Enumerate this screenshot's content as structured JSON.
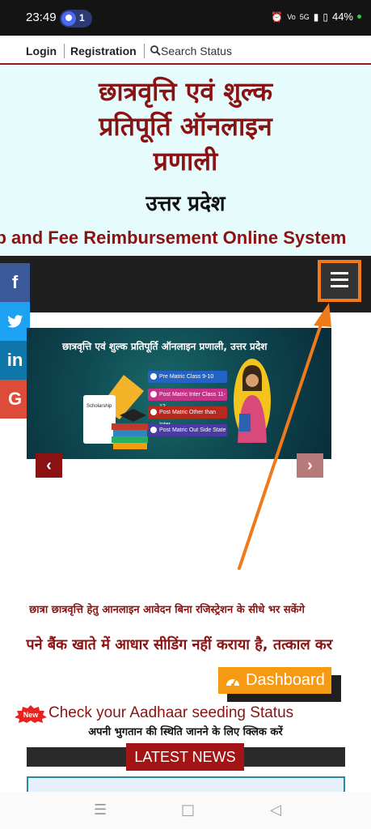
{
  "status_bar": {
    "time": "23:49",
    "notification_count": "1",
    "right_icons": [
      "alarm-icon",
      "volte-icon",
      "signal-icon",
      "battery-icon"
    ],
    "network": "5G",
    "battery": "44%"
  },
  "top_nav": {
    "login": "Login",
    "registration": "Registration",
    "search_status": "Search Status"
  },
  "header": {
    "title_line1": "छात्रवृत्ति एवं शुल्क",
    "title_line2": "प्रतिपूर्ति ऑनलाइन",
    "title_line3": "प्रणाली",
    "state": "उत्तर प्रदेश",
    "marquee_text": "Scholarship and Fee Reimbursement Online System"
  },
  "social": [
    {
      "name": "facebook",
      "glyph": "f",
      "color": "#3b5998"
    },
    {
      "name": "twitter",
      "glyph": "t",
      "color": "#1da1f2"
    },
    {
      "name": "linkedin",
      "glyph": "in",
      "color": "#0e76a8"
    },
    {
      "name": "google",
      "glyph": "G",
      "color": "#dd4b39"
    }
  ],
  "banner": {
    "title": "छात्रवृत्ति एवं शुल्क प्रतिपूर्ति ऑनलाइन प्रणाली, उत्तर प्रदेश",
    "scheme_label": "Scholarship",
    "options": [
      "Pre Matric Class 9-10",
      "Post Matric Inter Class 11-12",
      "Post Matric Other than Inter",
      "Post Matric Out Side State"
    ],
    "prev": "‹",
    "next": "›"
  },
  "marquee1": "छात्र छात्रा छात्रवृत्ति हेतु आनलाइन आवेदन बिना रजिस्ट्रेशन के सीधे भर सकेंगे",
  "marquee2": "जिन छात्रों ने अपने बैंक खाते में आधार सीडिंग नहीं कराया है, तत्काल करा लें",
  "dashboard": "Dashboard",
  "new_badge": "New",
  "aadhaar_link": "Check your Aadhaar seeding Status",
  "payment_link": "अपनी भुगतान की स्थिति जानने के लिए क्लिक करें",
  "latest_news": "LATEST NEWS",
  "colors": {
    "brand_maroon": "#8b1212",
    "header_bg": "#e6fbfb",
    "menubar": "#1f1f1f",
    "highlight_orange": "#f07a1a",
    "dashboard_orange": "#f79a13"
  },
  "android_nav": {
    "recent": "☰",
    "home": "□",
    "back": "◁"
  }
}
